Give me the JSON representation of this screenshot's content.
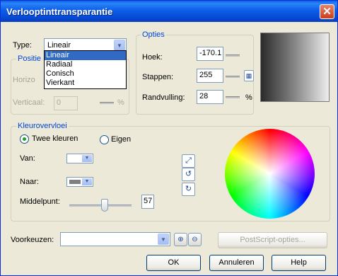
{
  "window": {
    "title": "Verlooptinttransparantie",
    "close_label": "✕"
  },
  "type": {
    "label": "Type:",
    "value": "Lineair",
    "options": [
      "Lineair",
      "Radiaal",
      "Conisch",
      "Vierkant"
    ]
  },
  "positie": {
    "group_label": "Positie",
    "horizontaal_label": "Horizo",
    "verticaal_label": "Verticaal:",
    "verticaal_value": "0",
    "unit": "%"
  },
  "opties": {
    "group_label": "Opties",
    "hoek_label": "Hoek:",
    "hoek_value": "-170.1",
    "stappen_label": "Stappen:",
    "stappen_value": "255",
    "randvulling_label": "Randvulling:",
    "randvulling_value": "28",
    "unit": "%"
  },
  "kleurovervloei": {
    "group_label": "Kleurovervloei",
    "twee_kleuren_label": "Twee kleuren",
    "twee_kleuren_checked": true,
    "eigen_label": "Eigen",
    "eigen_checked": false,
    "van_label": "Van:",
    "van_color": "#ffffff",
    "naar_label": "Naar:",
    "naar_color": "#808080",
    "middelpunt_label": "Middelpunt:",
    "middelpunt_value": "57",
    "middelpunt_fraction": 0.57
  },
  "voorkeuzen": {
    "label": "Voorkeuzen:",
    "value": ""
  },
  "buttons": {
    "postscript": "PostScript-opties...",
    "ok": "OK",
    "annuleren": "Annuleren",
    "help": "Help"
  },
  "icons": [
    "diagonal-arrow-icon",
    "rotate-ccw-icon",
    "rotate-cw-icon",
    "calculator-icon",
    "plus-icon",
    "minus-icon"
  ]
}
